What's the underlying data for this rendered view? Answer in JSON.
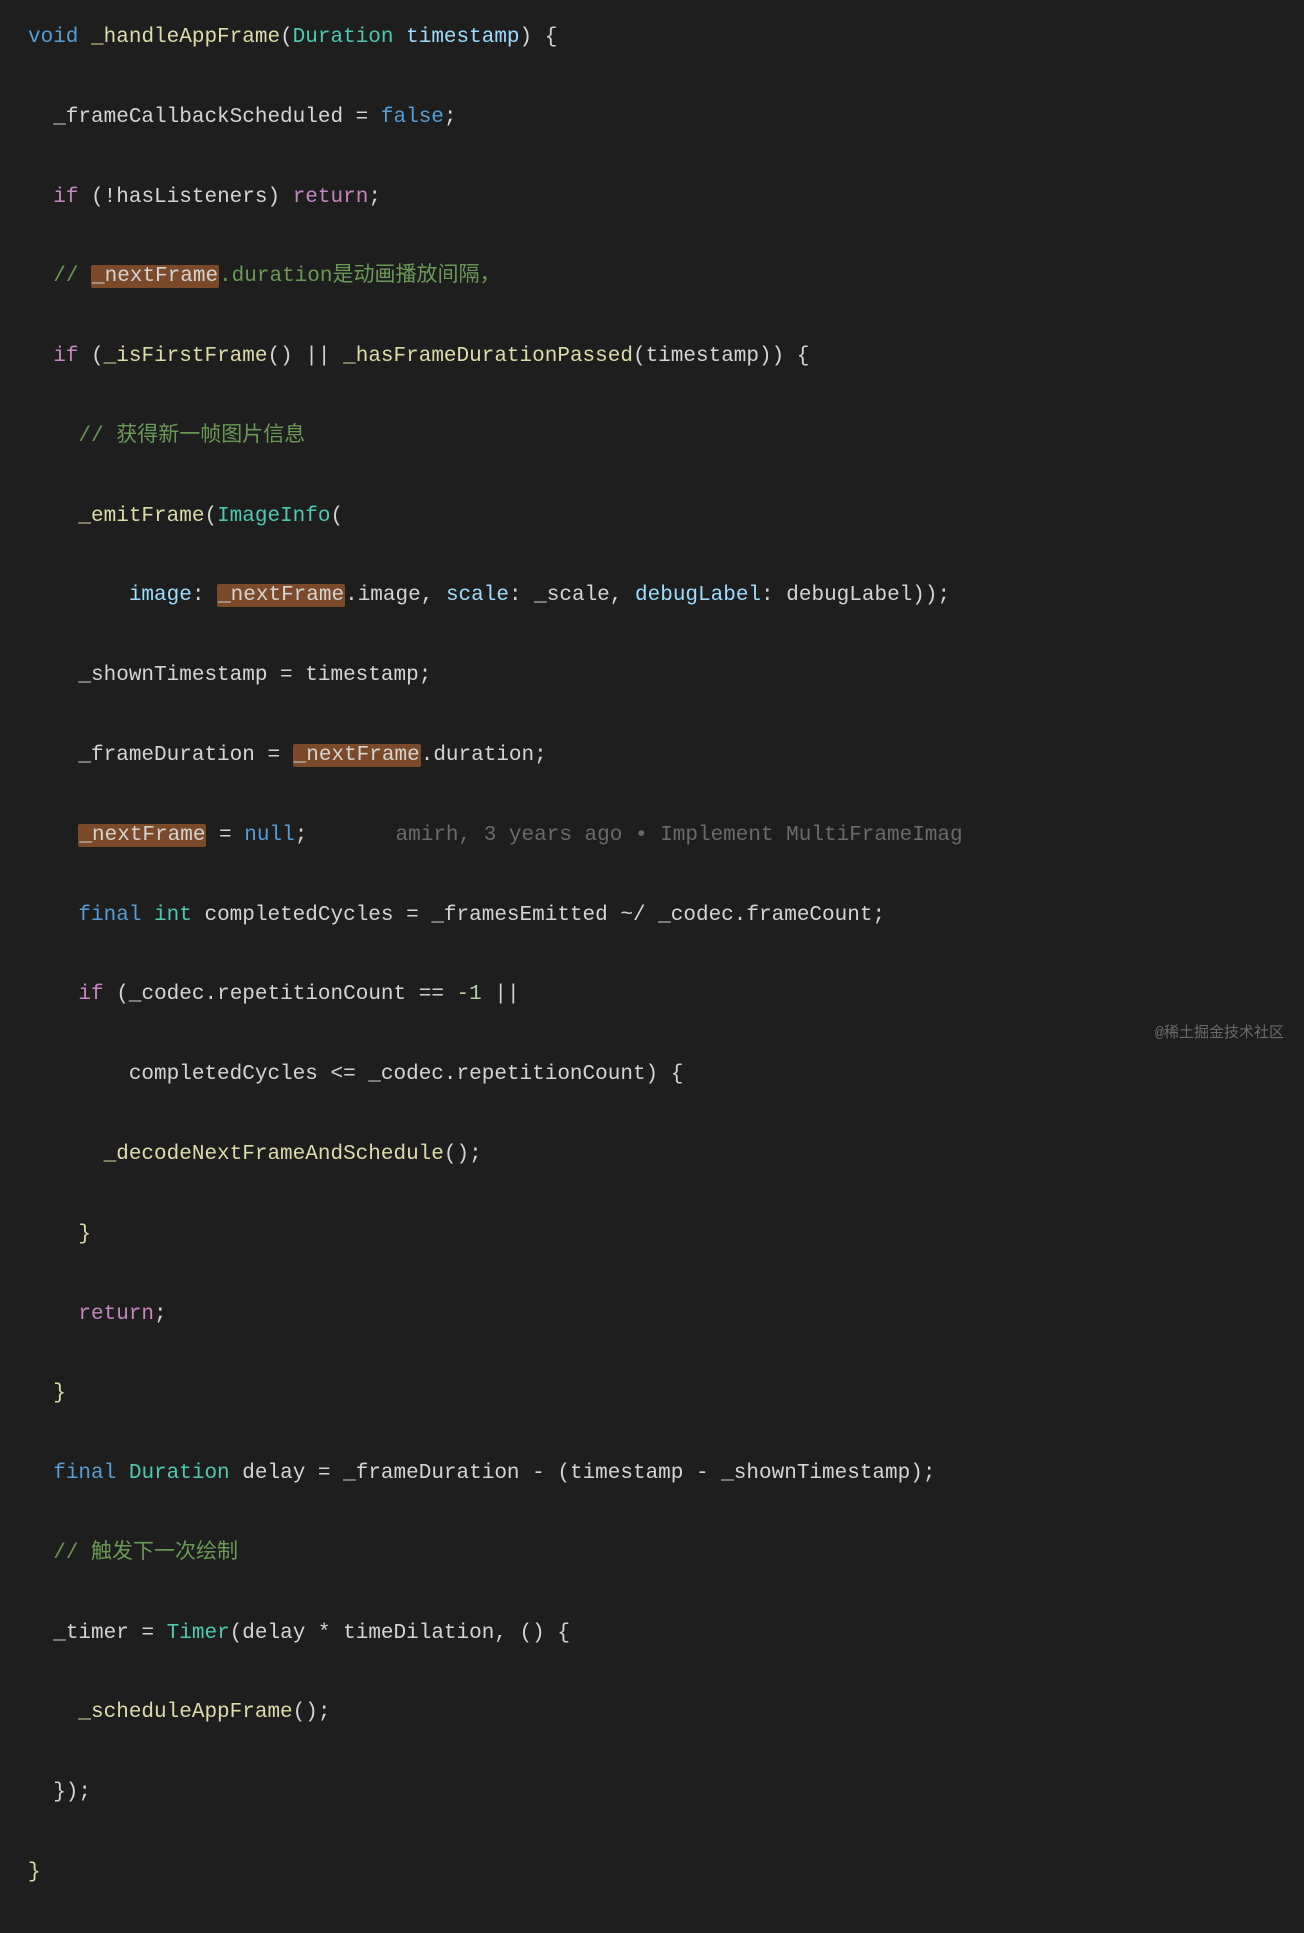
{
  "code": {
    "l1_void": "void",
    "l1_fn": "_handleAppFrame",
    "l1_type": "Duration",
    "l1_param": "timestamp",
    "l2_var": "_frameCallbackScheduled",
    "l2_false": "false",
    "l3_if": "if",
    "l3_cond": "hasListeners",
    "l3_return": "return",
    "l4_comment_pre": "// ",
    "l4_hl": "_nextFrame",
    "l4_comment_post": ".duration是动画播放间隔，",
    "l5_if": "if",
    "l5_fn1": "_isFirstFrame",
    "l5_fn2": "_hasFrameDurationPassed",
    "l5_arg": "timestamp",
    "l6_comment": "// 获得新一帧图片信息",
    "l7_fn": "_emitFrame",
    "l7_type": "ImageInfo",
    "l8_np1": "image",
    "l8_hl": "_nextFrame",
    "l8_prop1": "image",
    "l8_np2": "scale",
    "l8_val2": "_scale",
    "l8_np3": "debugLabel",
    "l8_val3": "debugLabel",
    "l9_var": "_shownTimestamp",
    "l9_val": "timestamp",
    "l10_var": "_frameDuration",
    "l10_hl": "_nextFrame",
    "l10_prop": "duration",
    "l11_hl": "_nextFrame",
    "l11_null": "null",
    "l11_blame": "amirh, 3 years ago • Implement MultiFrameImag",
    "l12_final": "final",
    "l12_int": "int",
    "l12_var": "completedCycles",
    "l12_fn": "_framesEmitted",
    "l12_obj": "_codec",
    "l12_prop": "frameCount",
    "l13_if": "if",
    "l13_obj": "_codec",
    "l13_prop": "repetitionCount",
    "l13_num": "-1",
    "l14_var": "completedCycles",
    "l14_obj": "_codec",
    "l14_prop": "repetitionCount",
    "l15_fn": "_decodeNextFrameAndSchedule",
    "l17_return": "return",
    "l19_final": "final",
    "l19_type": "Duration",
    "l19_var": "delay",
    "l19_v1": "_frameDuration",
    "l19_v2": "timestamp",
    "l19_v3": "_shownTimestamp",
    "l20_comment": "// 触发下一次绘制",
    "l21_var": "_timer",
    "l21_type": "Timer",
    "l21_arg1": "delay",
    "l21_arg2": "timeDilation",
    "l22_fn": "_scheduleAppFrame"
  },
  "watermark": "@稀土掘金技术社区"
}
